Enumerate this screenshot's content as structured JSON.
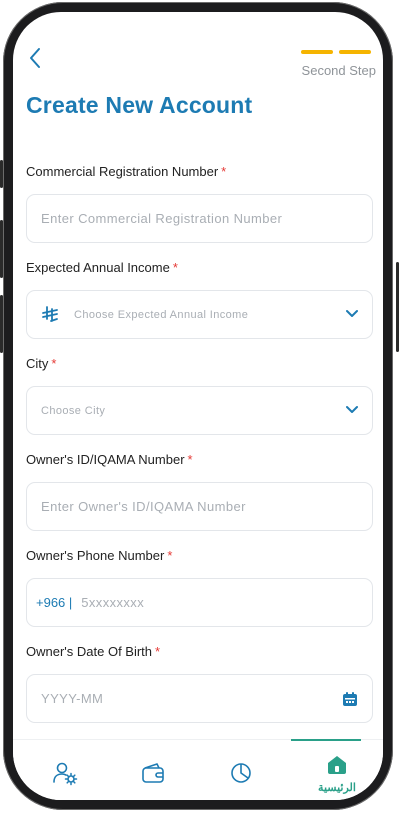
{
  "header": {
    "step_label": "Second Step",
    "title": "Create New Account"
  },
  "form": {
    "required_marker": "*",
    "crn": {
      "label": "Commercial Registration Number",
      "placeholder": "Enter Commercial Registration Number"
    },
    "income": {
      "label": "Expected Annual Income",
      "placeholder": "Choose Expected Annual Income"
    },
    "city": {
      "label": "City",
      "placeholder": "Choose City"
    },
    "owner_id": {
      "label": "Owner's ID/IQAMA Number",
      "placeholder": "Enter Owner's ID/IQAMA Number"
    },
    "phone": {
      "label": "Owner's Phone Number",
      "prefix": "+966 |",
      "placeholder": "5xxxxxxxx"
    },
    "dob": {
      "label": "Owner's Date Of Birth",
      "placeholder": "YYYY-MM"
    }
  },
  "tabbar": {
    "home_label": "الرئيسية"
  },
  "colors": {
    "accent": "#1d7bb3",
    "step": "#f5b400",
    "required": "#e53935",
    "tab_active": "#2aa089"
  }
}
